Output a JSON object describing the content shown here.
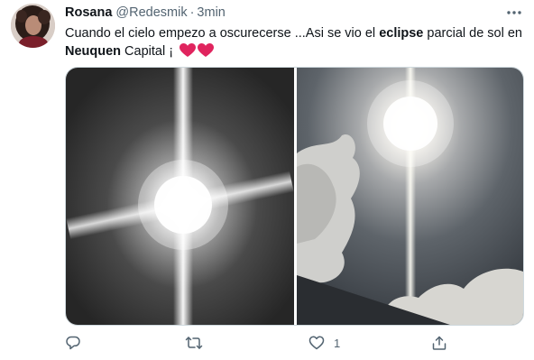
{
  "tweet": {
    "author_name": "Rosana",
    "handle": "@Redesmik",
    "separator": "·",
    "time": "3min",
    "text_parts": {
      "p1": "Cuando el cielo empezo a oscurecerse ...Asi se vio el ",
      "b1": "eclipse",
      "p2": " parcial de sol en ",
      "b2": "Neuquen",
      "p3": " Capital ¡"
    },
    "media": [
      {
        "description_icon": "sun-photo-grayscale"
      },
      {
        "description_icon": "sun-photo-clouds"
      }
    ],
    "actions": {
      "reply_count": "",
      "retweet_count": "",
      "like_count": "1",
      "share_count": ""
    }
  },
  "colors": {
    "text_primary": "#0f1419",
    "text_secondary": "#536471",
    "heart": "#e0245e",
    "border": "#cfd9de"
  }
}
